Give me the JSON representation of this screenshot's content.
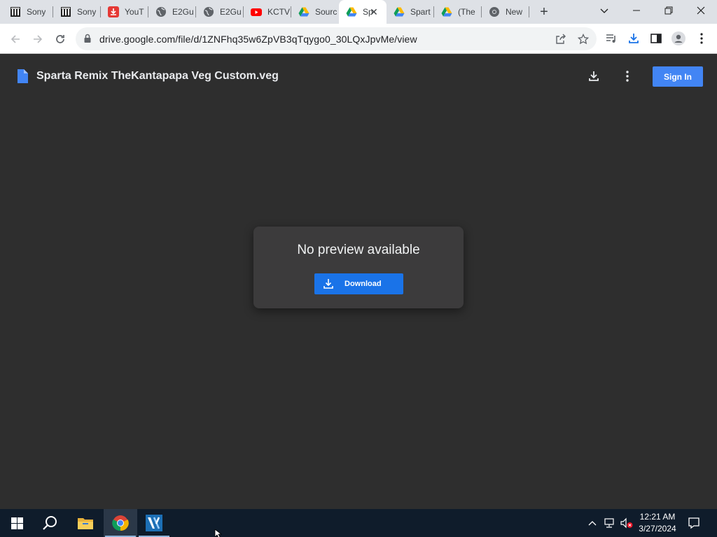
{
  "browser": {
    "tabs": [
      {
        "label": "Sony",
        "icon": "sony-museum-icon"
      },
      {
        "label": "Sony",
        "icon": "sony-museum-icon"
      },
      {
        "label": "YouT",
        "icon": "download-red-icon"
      },
      {
        "label": "E2Gu",
        "icon": "globe-icon"
      },
      {
        "label": "E2Gu",
        "icon": "globe-icon"
      },
      {
        "label": "KCTV",
        "icon": "youtube-icon"
      },
      {
        "label": "Sourc",
        "icon": "google-drive-icon"
      },
      {
        "label": "Sp",
        "icon": "google-drive-icon",
        "active": true
      },
      {
        "label": "Spart",
        "icon": "google-drive-icon"
      },
      {
        "label": "(The",
        "icon": "google-drive-icon"
      },
      {
        "label": "New",
        "icon": "chrome-icon"
      }
    ],
    "url": "drive.google.com/file/d/1ZNFhq35w6ZpVB3qTqygo0_30LQxJpvMe/view"
  },
  "drive": {
    "file_name": "Sparta Remix TheKantapapa Veg Custom.veg",
    "signin_label": "Sign In",
    "no_preview_text": "No preview available",
    "download_label": "Download"
  },
  "taskbar": {
    "time": "12:21 AM",
    "date": "3/27/2024"
  },
  "colors": {
    "accent": "#4285f4",
    "download_button": "#1a73e8",
    "viewer_background": "#2e2e2e",
    "card_background": "#3c3b3c",
    "taskbar_background": "#0f1c2b"
  }
}
